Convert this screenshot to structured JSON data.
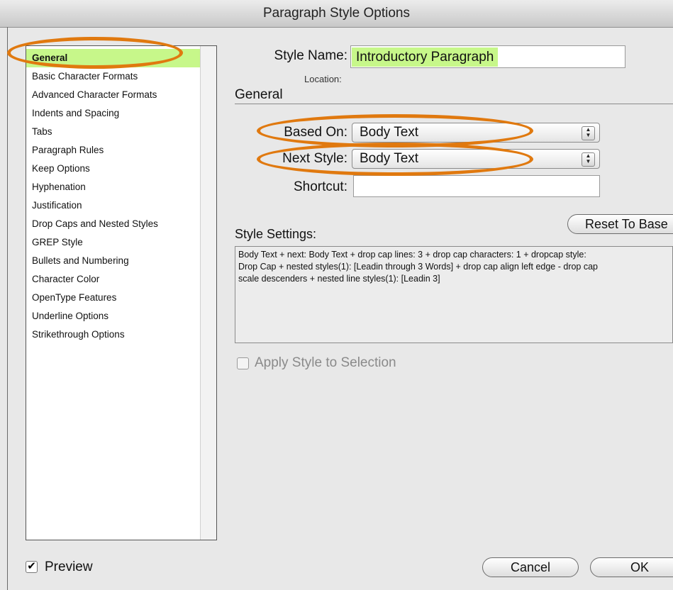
{
  "window": {
    "title": "Paragraph Style Options"
  },
  "sidebar": {
    "items": [
      "General",
      "Basic Character Formats",
      "Advanced Character Formats",
      "Indents and Spacing",
      "Tabs",
      "Paragraph Rules",
      "Keep Options",
      "Hyphenation",
      "Justification",
      "Drop Caps and Nested Styles",
      "GREP Style",
      "Bullets and Numbering",
      "Character Color",
      "OpenType Features",
      "Underline Options",
      "Strikethrough Options"
    ],
    "selected": "General"
  },
  "form": {
    "style_name_label": "Style Name:",
    "style_name_value": "Introductory Paragraph",
    "location_label": "Location:",
    "section_title": "General",
    "based_on_label": "Based On:",
    "based_on_value": "Body Text",
    "next_style_label": "Next Style:",
    "next_style_value": "Body Text",
    "shortcut_label": "Shortcut:",
    "shortcut_value": "",
    "reset_button": "Reset To Base",
    "style_settings_label": "Style Settings:",
    "style_settings_text": "Body Text + next: Body Text + drop cap lines:  3 + drop cap characters:  1 + dropcap style:\nDrop Cap + nested styles(1): [Leadin through 3 Words] + drop cap align left edge - drop cap\nscale descenders + nested line styles(1): [Leadin 3]",
    "apply_label": "Apply Style to Selection",
    "apply_checked": false
  },
  "footer": {
    "preview_label": "Preview",
    "preview_checked": true,
    "cancel_button": "Cancel",
    "ok_button": "OK"
  },
  "colors": {
    "selection_highlight": "#c7f78a",
    "annotation_outline": "#e0790f"
  }
}
